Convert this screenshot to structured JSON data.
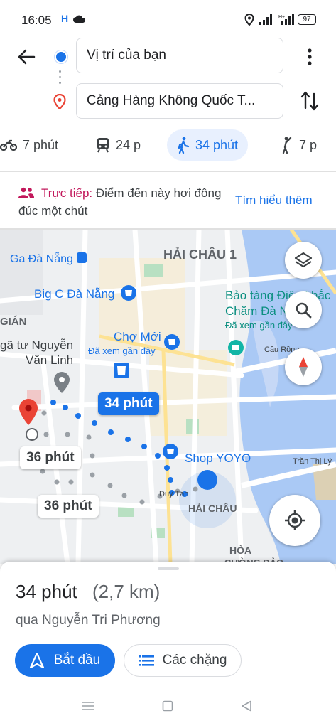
{
  "status_bar": {
    "time": "16:05",
    "battery": "97"
  },
  "directions": {
    "origin": "Vị trí của bạn",
    "destination": "Cảng Hàng Không Quốc T..."
  },
  "modes": [
    {
      "icon": "motorbike-icon",
      "label": "7 phút"
    },
    {
      "icon": "transit-icon",
      "label": "24 p"
    },
    {
      "icon": "walk-icon",
      "label": "34 phút",
      "selected": true
    },
    {
      "icon": "hail-icon",
      "label": "7 p"
    }
  ],
  "live_info": {
    "prefix": "Trực tiếp:",
    "text": " Điểm đến này hơi đông đúc một chút",
    "link": "Tìm hiểu thêm"
  },
  "map": {
    "labels": {
      "hai_chau_1": "HẢI CHÂU 1",
      "ga_da_nang": "Ga Đà Nẵng",
      "big_c": "Big C Đà Nẵng",
      "bao_tang_1": "Bảo tàng Điêu khắc",
      "bao_tang_2": "Chăm Đà N...",
      "bao_tang_sub": "Đã xem gần đây",
      "gian": "GIÁN",
      "nga_tu_1": "gã tư Nguyễn",
      "nga_tu_2": "Văn Linh",
      "cho_moi": "Chợ Mới",
      "cho_moi_sub": "Đã xem gần đây",
      "cau_rong": "Cầu Rồng",
      "shop": "Shop YOYO",
      "tran_thi_ly": "Trần Thị Lý",
      "duy_tan": "Duy Tân",
      "hai_chau": "HẢI CHÂU",
      "hoa": "HÒA",
      "cuong_dao": "CƯỜNG ĐẢO"
    },
    "route_labels": {
      "selected": "34 phút",
      "alt1": "36 phút",
      "alt2": "36 phút"
    },
    "controls": [
      "layers-icon",
      "search-icon",
      "compass-icon",
      "my-location-icon"
    ],
    "colors": {
      "water": "#aac9f5",
      "route": "#1a73e8",
      "alt_route": "#9aa0a6",
      "pin": "#ea4335"
    }
  },
  "summary": {
    "duration": "34 phút",
    "distance": "(2,7 km)",
    "via": "qua Nguyễn Tri Phương",
    "start_button": "Bắt đầu",
    "steps_button": "Các chặng"
  }
}
